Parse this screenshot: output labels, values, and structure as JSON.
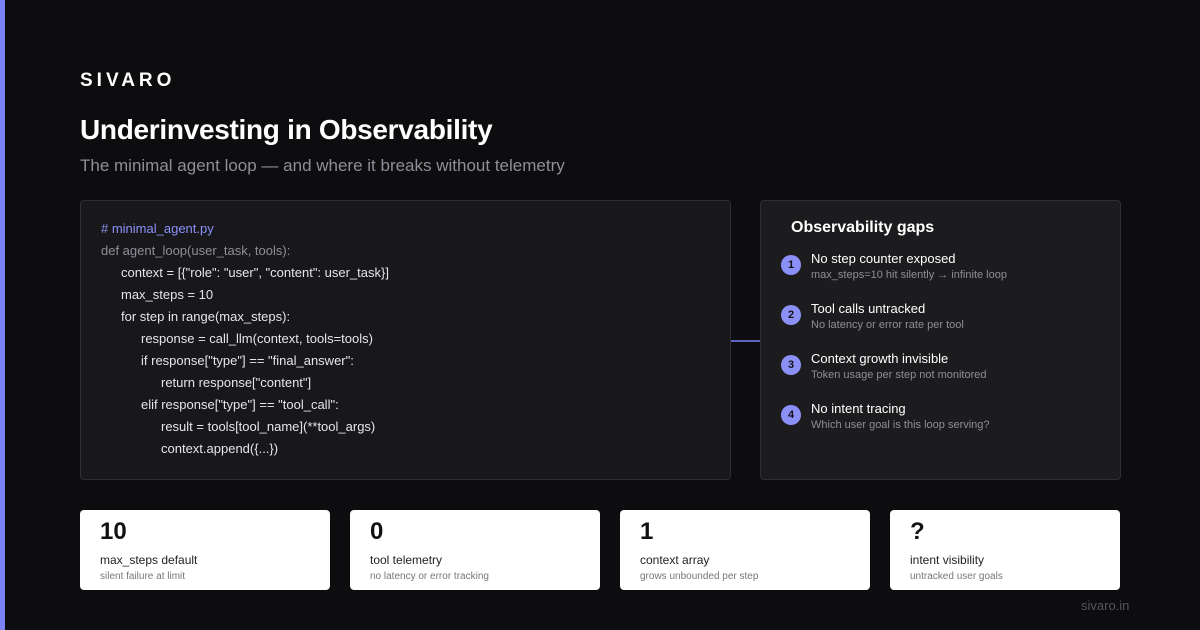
{
  "brand": "SIVARO",
  "title": "Underinvesting in Observability",
  "subtitle": "The minimal agent loop — and where it breaks without telemetry",
  "code": {
    "lines": [
      {
        "text": "# minimal_agent.py",
        "kind": "comment",
        "indent": 0
      },
      {
        "text": "def agent_loop(user_task, tools):",
        "kind": "def",
        "indent": 0
      },
      {
        "text": "context = [{\"role\": \"user\", \"content\": user_task}]",
        "kind": "code",
        "indent": 1
      },
      {
        "text": "max_steps = 10",
        "kind": "code",
        "indent": 1
      },
      {
        "text": "for step in range(max_steps):",
        "kind": "code",
        "indent": 1
      },
      {
        "text": "response = call_llm(context, tools=tools)",
        "kind": "code",
        "indent": 2
      },
      {
        "text": "if response[\"type\"] == \"final_answer\":",
        "kind": "code",
        "indent": 2
      },
      {
        "text": "return response[\"content\"]",
        "kind": "code",
        "indent": 3
      },
      {
        "text": "elif response[\"type\"] == \"tool_call\":",
        "kind": "code",
        "indent": 2
      },
      {
        "text": "result = tools[tool_name](**tool_args)",
        "kind": "code",
        "indent": 3
      },
      {
        "text": "context.append({...})",
        "kind": "code",
        "indent": 3
      }
    ]
  },
  "gaps": {
    "title": "Observability gaps",
    "items": [
      {
        "num": "1",
        "title": "No step counter exposed",
        "desc": "max_steps=10 hit silently → infinite loop"
      },
      {
        "num": "2",
        "title": "Tool calls untracked",
        "desc": "No latency or error rate per tool"
      },
      {
        "num": "3",
        "title": "Context growth invisible",
        "desc": "Token usage per step not monitored"
      },
      {
        "num": "4",
        "title": "No intent tracing",
        "desc": "Which user goal is this loop serving?"
      }
    ]
  },
  "stats": [
    {
      "value": "10",
      "label": "max_steps default",
      "desc": "silent failure at limit"
    },
    {
      "value": "0",
      "label": "tool telemetry",
      "desc": "no latency or error tracking"
    },
    {
      "value": "1",
      "label": "context array",
      "desc": "grows unbounded per step"
    },
    {
      "value": "?",
      "label": "intent visibility",
      "desc": "untracked user goals"
    }
  ],
  "footer": "sivaro.in",
  "colors": {
    "background": "#0d0d0f",
    "accent": "#7b82f5",
    "badge": "#8b90f7",
    "panel": "#18181b",
    "card": "#ffffff"
  }
}
